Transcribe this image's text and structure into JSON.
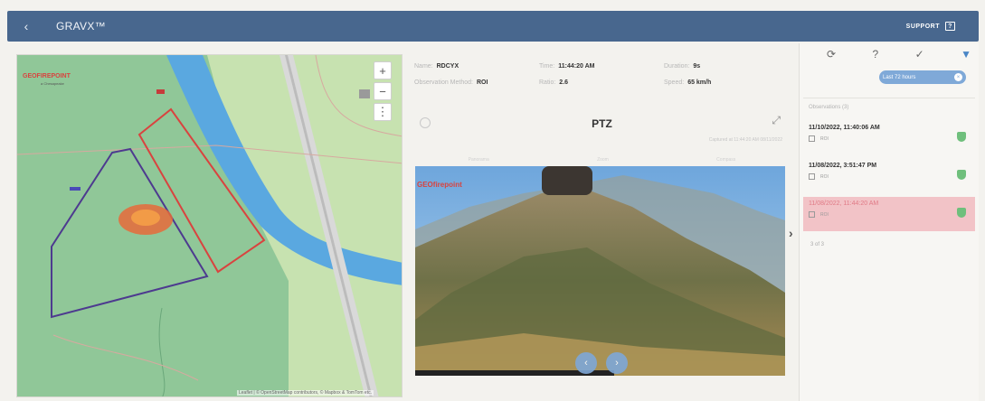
{
  "header": {
    "back_icon": "arrow-left-icon",
    "title": "GRAVX™",
    "support_label": "SUPPORT"
  },
  "map": {
    "logo_text": "GEOFIREPOINT",
    "logo_subtext": "a Chesapeake",
    "zoom_in": "+",
    "zoom_out": "−",
    "menu": "⋮",
    "attribution": "Leaflet | © OpenStreetMap contributors, © Mapbox & TomTom etc."
  },
  "info": {
    "fields": [
      {
        "label": "Name:",
        "value": "RDCYX"
      },
      {
        "label": "Observation Method:",
        "value": "ROI"
      },
      {
        "label": "Time:",
        "value": "11:44:20 AM"
      },
      {
        "label": "Ratio:",
        "value": "2.6"
      },
      {
        "label": "Duration:",
        "value": "9s"
      },
      {
        "label": "Speed:",
        "value": "65 km/h"
      }
    ]
  },
  "camera": {
    "title": "PTZ",
    "timestamp": "Captured at 11:44:20 AM 08/11/2022",
    "faded_labels": [
      "Panorama",
      "Zoom",
      "Compass"
    ],
    "image_logo": "GEOfirepoint",
    "prev_icon": "chevron-left-icon",
    "next_icon": "chevron-right-icon"
  },
  "panel": {
    "toolbar": {
      "refresh": "⟳",
      "help": "?",
      "check": "✓",
      "filter": "▼"
    },
    "filter_pill": "Last 72 hours",
    "observations_title": "Observations (3)",
    "observations": [
      {
        "time": "11/10/2022, 11:40:06 AM",
        "type": "ROI",
        "selected": false
      },
      {
        "time": "11/08/2022, 3:51:47 PM",
        "type": "ROI",
        "selected": false
      },
      {
        "time": "11/08/2022, 11:44:20 AM",
        "type": "ROI",
        "selected": true
      }
    ],
    "count_text": "3 of 3"
  },
  "colors": {
    "header_bg": "#48678e",
    "selected_row": "#f2c3c7",
    "accent_blue": "#4a86c6",
    "status_green": "#6fbf7c",
    "polygon_red": "#d9433f",
    "polygon_purple": "#4d3a8f"
  }
}
